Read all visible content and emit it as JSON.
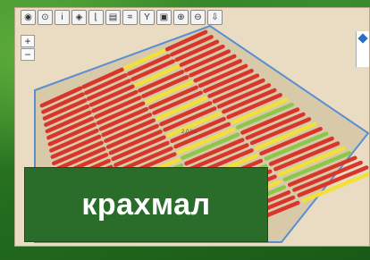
{
  "toolbar": {
    "buttons": [
      "eye-icon",
      "target-icon",
      "info-icon",
      "layer-icon",
      "ruler-icon",
      "table-icon",
      "crop-icon",
      "filter-icon",
      "select-icon",
      "zoom-in-icon",
      "zoom-out-icon",
      "download-icon"
    ]
  },
  "zoom": {
    "plus": "+",
    "minus": "−"
  },
  "caption": {
    "text": "крахмал"
  },
  "map": {
    "label": "2.0 ha"
  },
  "colors": {
    "red": "#d8362a",
    "yellow": "#f2e03a",
    "green": "#8cc64a",
    "field_fill": "#d9c9a6",
    "outline": "#5b8ed1"
  }
}
